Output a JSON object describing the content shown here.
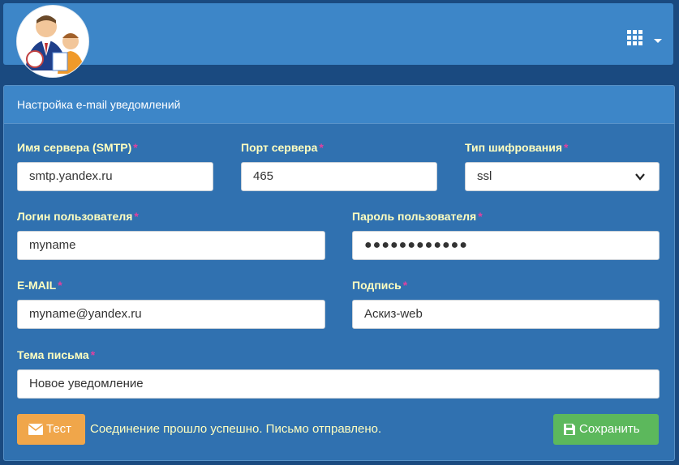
{
  "header": {
    "avatar_icon": "user-avatar-icon",
    "apps_icon": "grid-icon"
  },
  "panel": {
    "title": "Настройка e-mail уведомлений"
  },
  "fields": {
    "server": {
      "label": "Имя сервера (SMTP)",
      "required": "*",
      "value": "smtp.yandex.ru"
    },
    "port": {
      "label": "Порт сервера",
      "required": "*",
      "value": "465"
    },
    "encryption": {
      "label": "Тип шифрования",
      "required": "*",
      "value": "ssl"
    },
    "login": {
      "label": "Логин пользователя",
      "required": "*",
      "value": "myname"
    },
    "password": {
      "label": "Пароль пользователя",
      "required": "*",
      "value": "●●●●●●●●●●●●"
    },
    "email": {
      "label": "E-MAIL",
      "required": "*",
      "value": "myname@yandex.ru"
    },
    "signature": {
      "label": "Подпись",
      "required": "*",
      "value": "Аскиз-web"
    },
    "subject": {
      "label": "Тема письма",
      "required": "*",
      "value": "Новое уведомление"
    }
  },
  "actions": {
    "test_label": "Тест",
    "status_text": "Соединение прошло успешно. Письмо отправлено.",
    "save_label": "Сохранить"
  },
  "colors": {
    "background": "#1a4a80",
    "accent": "#3d86c8",
    "label": "#ffffc0",
    "required": "#e040a0",
    "test_button": "#f0a64a",
    "save_button": "#5cb85c"
  }
}
